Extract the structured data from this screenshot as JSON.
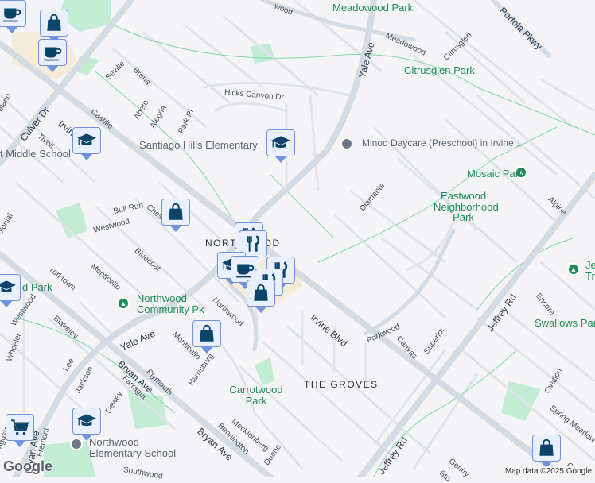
{
  "colors": {
    "background": "#f4f3f5",
    "major_road": "#d4dbe3",
    "minor_road": "#dfe4ea",
    "park": "#c2ecd4",
    "commercial": "#f4ecd9",
    "trail": "#6fd3a2",
    "pin_fill": "#e9effd",
    "pin_border": "#6f93dc",
    "pin_icon": "#0b4468",
    "park_text": "#1e8c5a"
  },
  "neighborhoods": {
    "northwood": "NORTHWOOD",
    "groves": "THE GROVES"
  },
  "parks": {
    "meadowood": "Meadowood Park",
    "citrusglen": "Citrusglen Park",
    "mosaic": "Mosaic Park",
    "eastwood": "Eastwood Neighborhood Park",
    "northwood_community": "Northwood Community Pk",
    "carrotwood": "Carrotwood Park",
    "swallows": "Swallows Park",
    "d_park": "d Park",
    "je_tr": "Je Tr"
  },
  "pois": {
    "santiago": "Santiago Hills Elementary",
    "minoo": "Minoo Daycare (Preschool) in Irvine...",
    "middle_school": "t Middle School",
    "northwood_elem": "Northwood Elementary School"
  },
  "streets": {
    "irvine_blvd_1": "Irvine Blvd",
    "irvine_blvd_2": "Irvine Blvd",
    "culver": "Culver Dr",
    "yale_top": "Yale Ave",
    "yale_bottom": "Yale Ave",
    "bryan_1": "Bryan Ave",
    "bryan_2": "Bryan Ave",
    "bryan_3": "Bryan Ave",
    "jeffrey_1": "Jeffrey Rd",
    "jeffrey_2": "Jeffrey Rd",
    "portola": "Portola Pkwy",
    "meadowood": "Meadowood",
    "meadowood_top": "wood",
    "citrusglen": "Citrusglen",
    "hicks": "Hicks Canyon Dr",
    "seville": "Seville",
    "brena": "Brena",
    "castillo": "Castillo",
    "abeto": "Abeto",
    "alegria": "Alegria",
    "park_pl": "Park Pl",
    "tivoli": "Tivoli",
    "elano": "elano",
    "diamante": "Diamante",
    "alpine": "Alpine",
    "bull_run": "Bull Run",
    "chesapeake": "Ches",
    "westwood_1": "Westwood",
    "westwood_2": "Westwood",
    "colonial": "olonial",
    "yorktown": "Yorktown",
    "monticello_1": "Monticello",
    "monticello_2": "Monticello",
    "bluecoat": "Bluecoat",
    "blakeley": "Blakeley",
    "wheeler": "Wheeler",
    "lee": "Lee",
    "northwood": "Northwood",
    "plymouth": "Plymouth",
    "harrisburg": "Harrisburg",
    "jackson": "Jackson",
    "farragut": "Farragut",
    "dewey": "Dewey",
    "augusta": "ugusta",
    "fremont": "Fremont",
    "southwood": "Southwood",
    "mecklenberg": "Mecklenberg",
    "bennington": "Bennington",
    "duane": "Duane",
    "parkwood": "Parkwood",
    "canvas": "Canvas",
    "superior": "Superior",
    "encore": "Encore",
    "ovation": "Ovation",
    "spring_meadow": "Spring Meadow",
    "gentry": "Gentry",
    "stone": "Sto",
    "cro": "Cro"
  },
  "markers": [
    {
      "type": "cafe",
      "icon": "coffee-cup-icon"
    },
    {
      "type": "shopping",
      "icon": "shopping-bag-icon"
    },
    {
      "type": "cafe",
      "icon": "coffee-cup-icon"
    },
    {
      "type": "school",
      "icon": "graduation-cap-icon"
    },
    {
      "type": "school",
      "icon": "graduation-cap-icon"
    },
    {
      "type": "shopping",
      "icon": "shopping-bag-icon"
    },
    {
      "type": "restaurant",
      "icon": "fork-knife-icon"
    },
    {
      "type": "shopping",
      "icon": "shopping-bag-icon"
    },
    {
      "type": "shopping",
      "icon": "shopping-bag-icon"
    },
    {
      "type": "school",
      "icon": "graduation-cap-icon"
    },
    {
      "type": "grocery",
      "icon": "shopping-cart-icon"
    },
    {
      "type": "school",
      "icon": "graduation-cap-icon"
    },
    {
      "type": "shopping",
      "icon": "shopping-bag-icon"
    }
  ],
  "logo": "Google",
  "attribution": "Map data ©2025 Google"
}
